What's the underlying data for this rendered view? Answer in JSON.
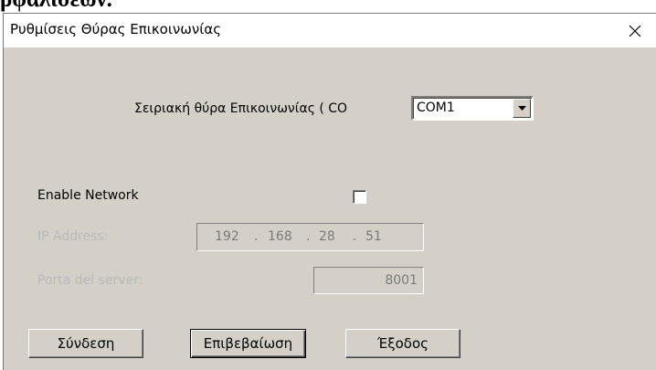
{
  "document_fragment": "ρφαλίσεων.",
  "dialog": {
    "title": "Ρυθμίσεις Θύρας Επικοινωνίας",
    "close_glyph": "✕"
  },
  "serial": {
    "label": "Σειριακή θύρα Επικοινωνίας ( CO",
    "selected_port": "COM1"
  },
  "network": {
    "enable_label": "Enable Network",
    "enabled": false,
    "ip_label": "IP Address:",
    "ip_octets": [
      "192",
      "168",
      "28",
      "51"
    ],
    "port_label": "Porta del server:",
    "port_value": "8001"
  },
  "buttons": {
    "connect": "Σύνδεση",
    "confirm": "Επιβεβαίωση",
    "exit": "Έξοδος"
  }
}
